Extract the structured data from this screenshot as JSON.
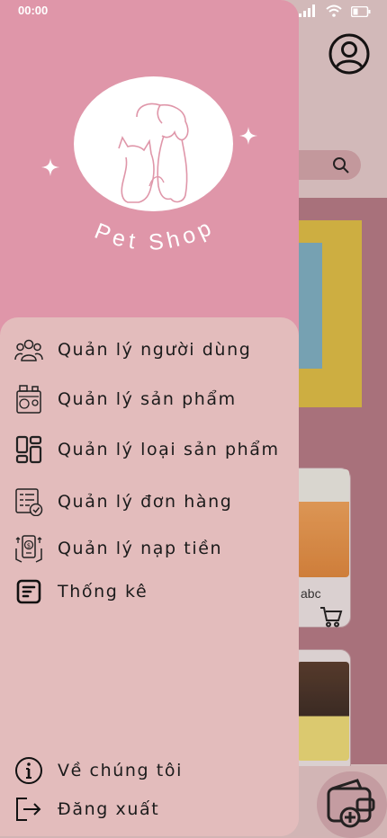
{
  "status_bar": {
    "time": "00:00"
  },
  "brand": {
    "name": "Pet Shop"
  },
  "menu": [
    {
      "label": "Quản lý người dùng",
      "icon": "users-icon"
    },
    {
      "label": "Quản lý sản phẩm",
      "icon": "pet-products-icon"
    },
    {
      "label": "Quản lý loại sản phẩm",
      "icon": "category-layout-icon"
    },
    {
      "label": "Quản lý đơn hàng",
      "icon": "order-checklist-icon"
    },
    {
      "label": "Quản lý nạp tiền",
      "icon": "money-topup-icon"
    },
    {
      "label": "Thống kê",
      "icon": "statistics-icon"
    }
  ],
  "footer_menu": [
    {
      "label": "Về chúng tôi",
      "icon": "info-icon"
    },
    {
      "label": "Đăng xuất",
      "icon": "logout-icon"
    }
  ],
  "background": {
    "product_label": "abc"
  },
  "colors": {
    "drawer_header": "#df96a9",
    "drawer_body": "#e3bcbc"
  }
}
